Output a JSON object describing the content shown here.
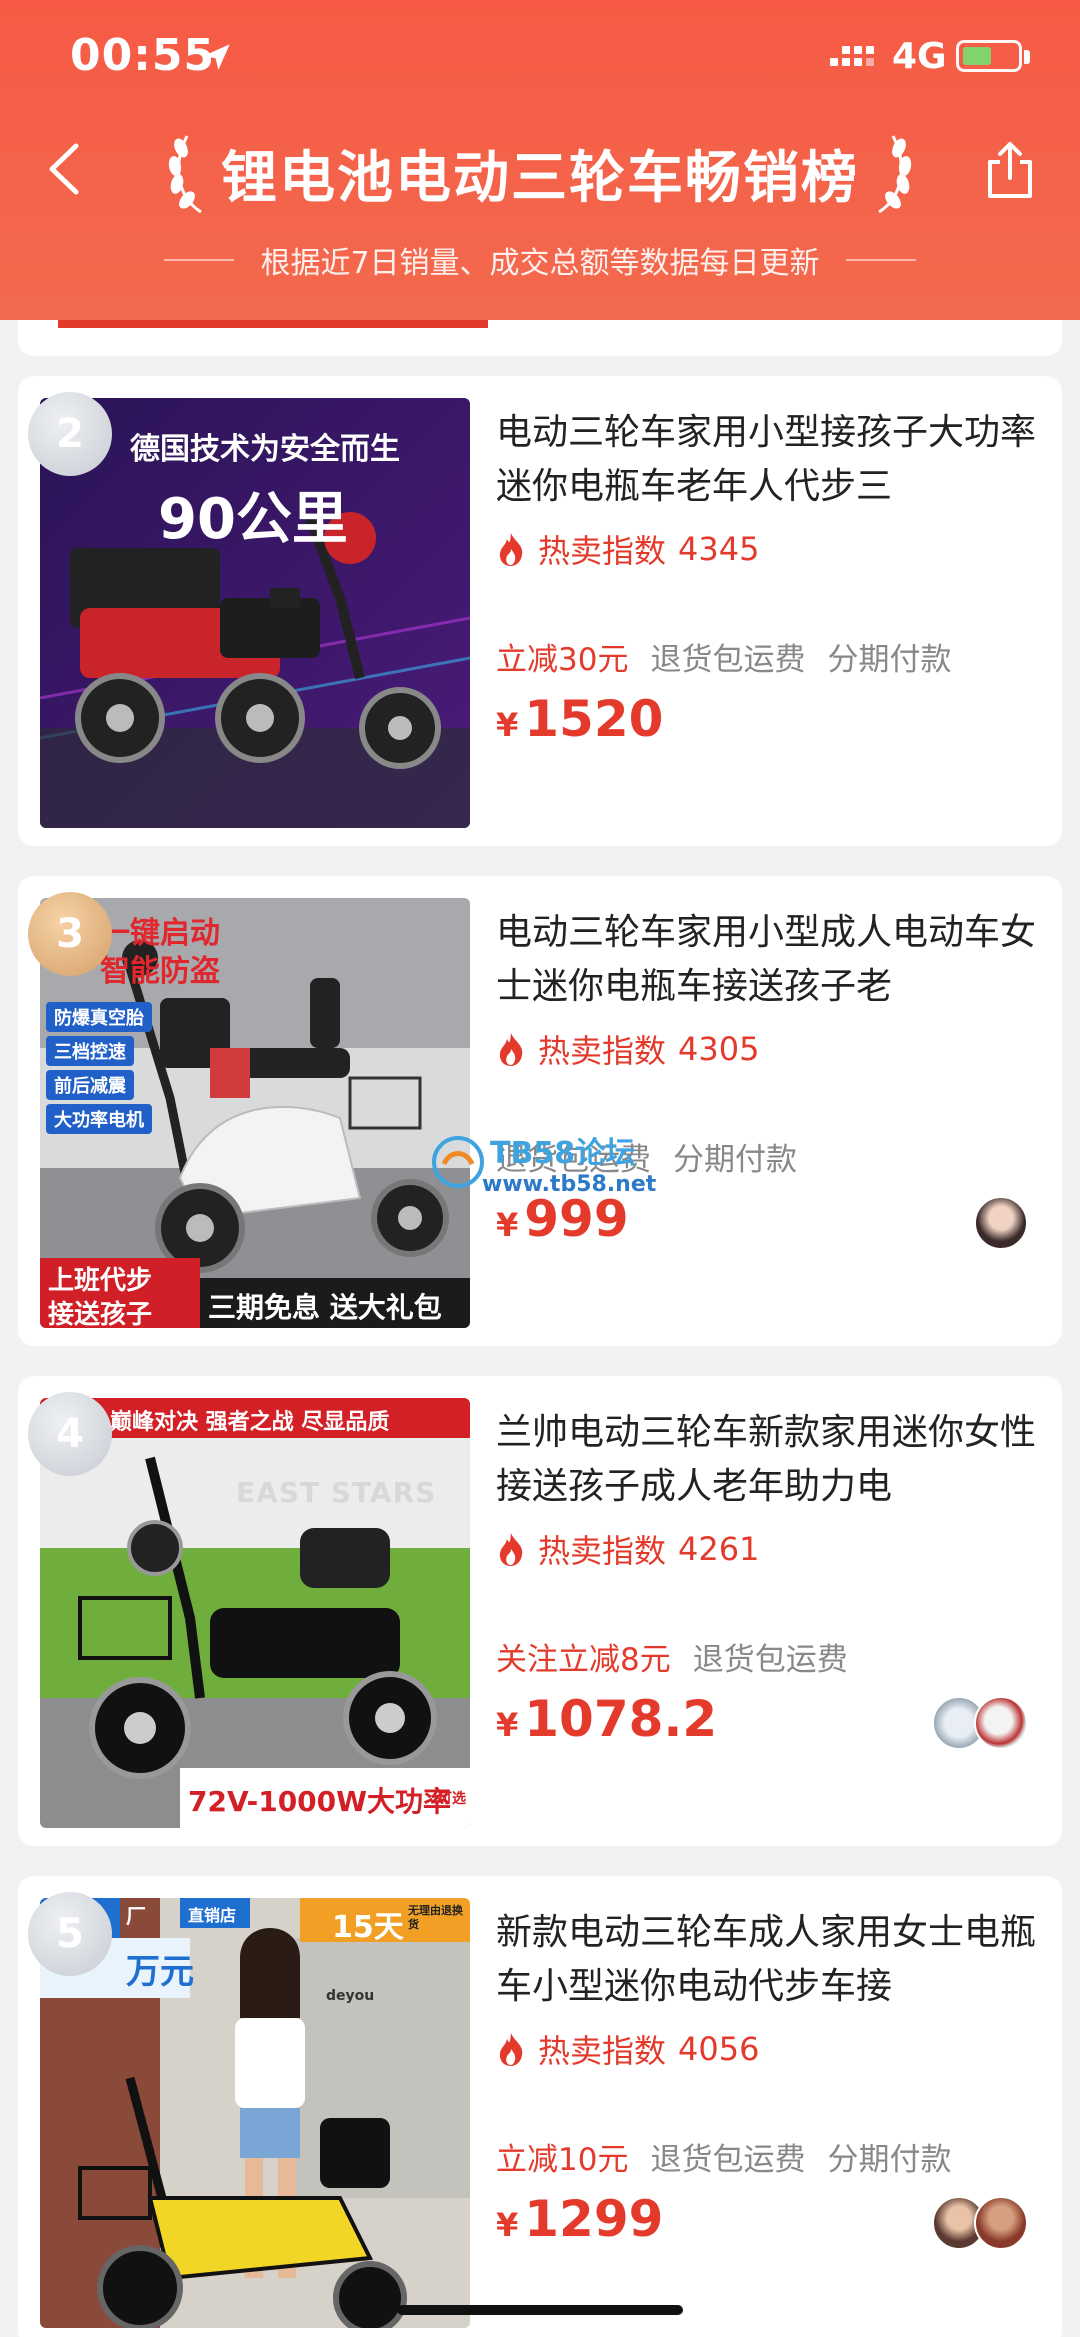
{
  "status_bar": {
    "time": "00:55",
    "network": "4G"
  },
  "header": {
    "title": "锂电池电动三轮车畅销榜",
    "subtitle": "根据近7日销量、成交总额等数据每日更新"
  },
  "products": [
    {
      "rank": "2",
      "title": "电动三轮车家用小型接孩子大功率迷你电瓶车老年人代步三",
      "hot_label": "热卖指数",
      "hot_value": "4345",
      "tags": [
        "立减30元",
        "退货包运费",
        "分期付款"
      ],
      "currency": "¥",
      "price": "1520",
      "image_text": [
        "德国技术为安全而生",
        "90公里"
      ]
    },
    {
      "rank": "3",
      "title": "电动三轮车家用小型成人电动车女士迷你电瓶车接送孩子老",
      "hot_label": "热卖指数",
      "hot_value": "4305",
      "tags": [
        "退货包运费",
        "分期付款"
      ],
      "currency": "¥",
      "price": "999",
      "image_text": [
        "一键启动",
        "智能防盗",
        "防爆真空胎",
        "三档控速",
        "前后减震",
        "大功率电机",
        "上班代步",
        "接送孩子",
        "三期免息 送大礼包"
      ]
    },
    {
      "rank": "4",
      "title": "兰帅电动三轮车新款家用迷你女性接送孩子成人老年助力电",
      "hot_label": "热卖指数",
      "hot_value": "4261",
      "tags": [
        "关注立减8元",
        "退货包运费"
      ],
      "currency": "¥",
      "price": "1078.2",
      "image_text": [
        "巅峰对决  强者之战  尽显品质",
        "EAST STARS",
        "72V-1000W大功率",
        "可选"
      ]
    },
    {
      "rank": "5",
      "title": "新款电动三轮车成人家用女士电瓶车小型迷你电动代步车接",
      "hot_label": "热卖指数",
      "hot_value": "4056",
      "tags": [
        "立减10元",
        "退货包运费",
        "分期付款"
      ],
      "currency": "¥",
      "price": "1299",
      "image_text": [
        "厂",
        "直销店",
        "万元",
        "15天",
        "无理由退换货",
        "deyou"
      ]
    }
  ],
  "watermark": {
    "title": "TB58论坛",
    "url": "www.tb58.net"
  },
  "colors": {
    "header": "#f65a44",
    "accent": "#e43a2c",
    "tag_gray": "#888888"
  }
}
